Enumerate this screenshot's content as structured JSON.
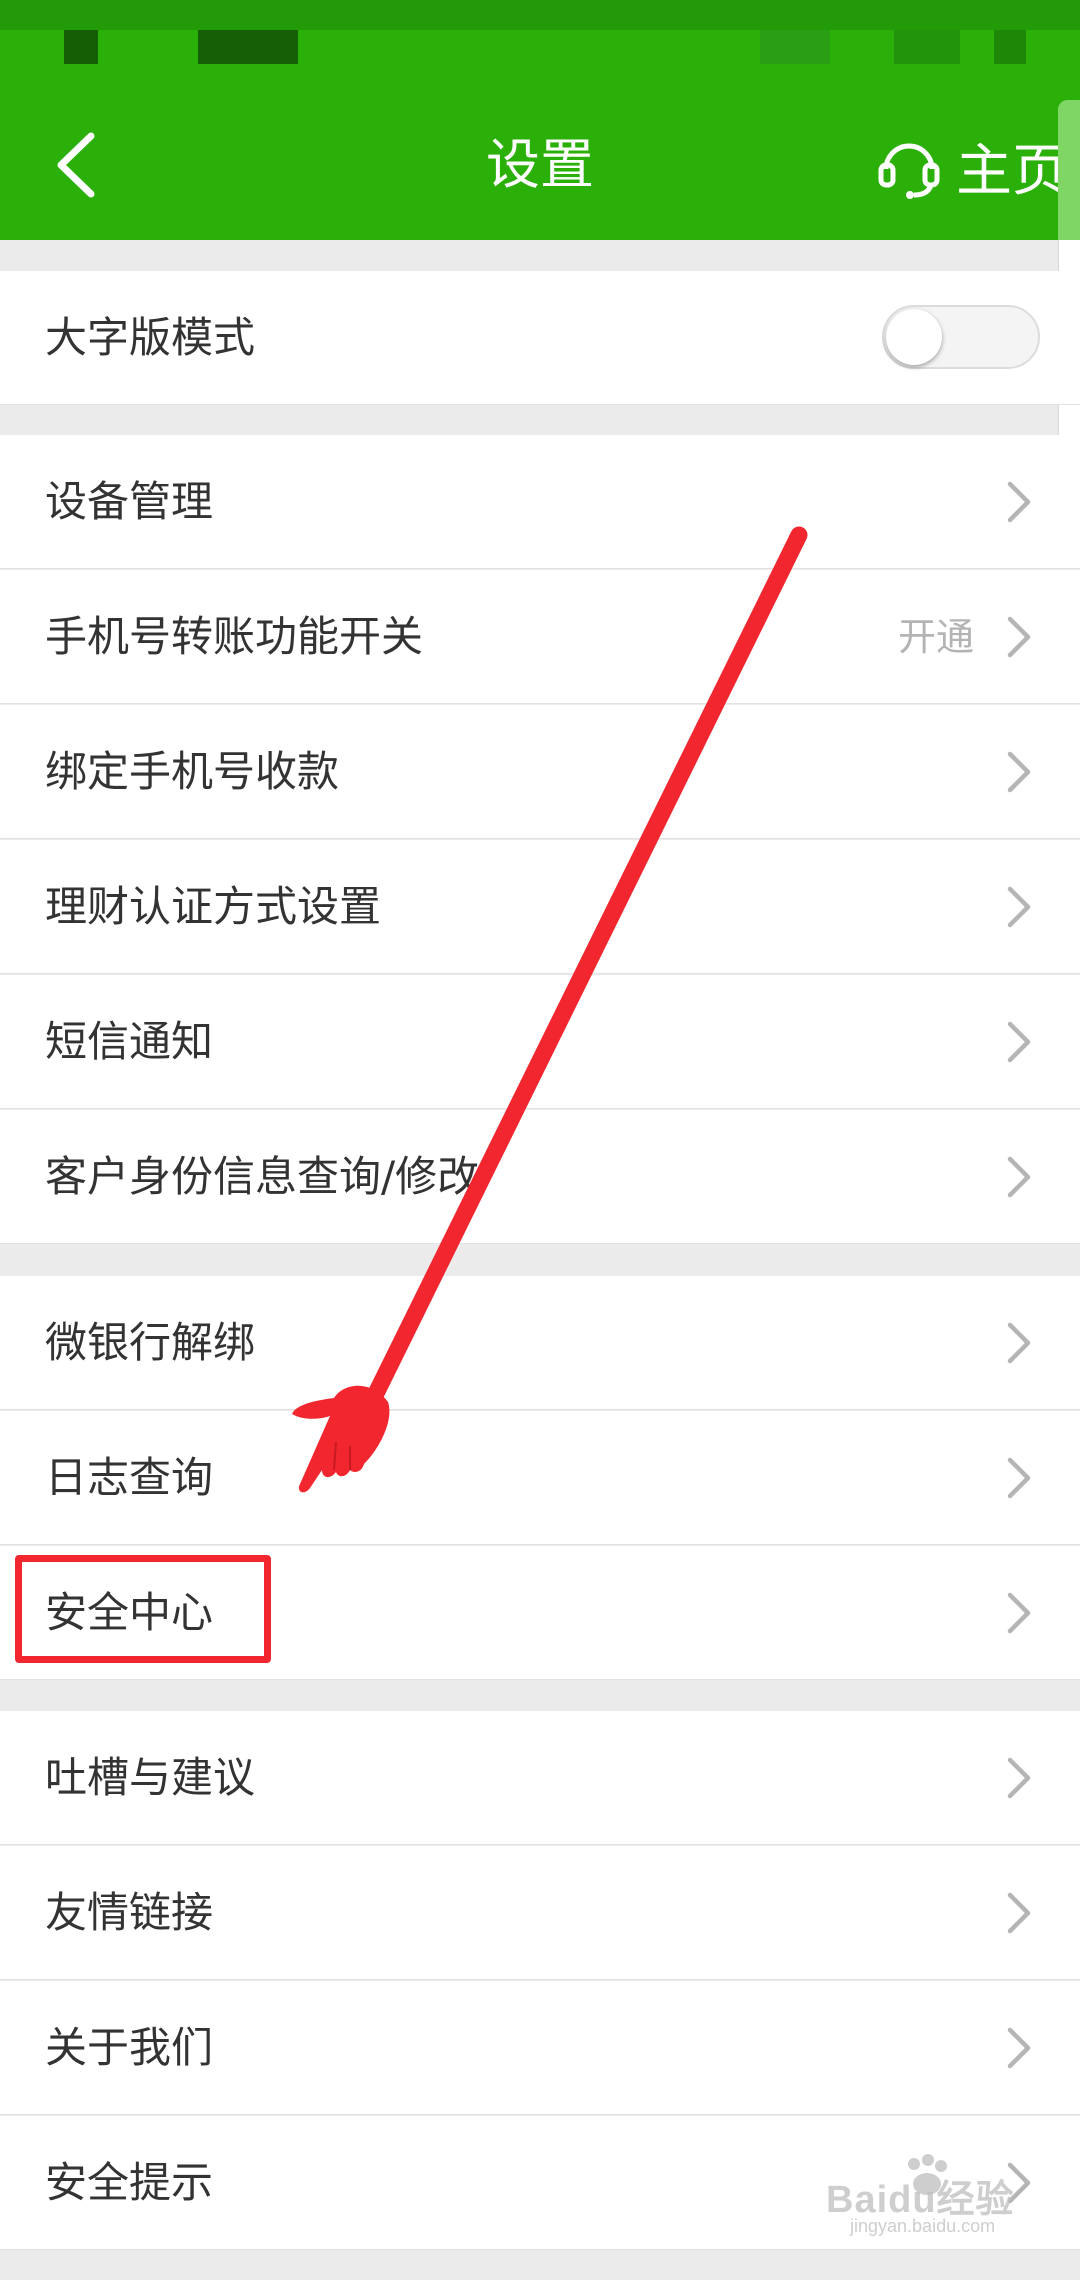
{
  "header": {
    "title": "设置",
    "home_label": "主页"
  },
  "toggle_row": {
    "label": "大字版模式",
    "enabled": false
  },
  "groups": [
    {
      "items": [
        {
          "label": "设备管理",
          "value": ""
        },
        {
          "label": "手机号转账功能开关",
          "value": "开通"
        },
        {
          "label": "绑定手机号收款",
          "value": ""
        },
        {
          "label": "理财认证方式设置",
          "value": ""
        },
        {
          "label": "短信通知",
          "value": ""
        },
        {
          "label": "客户身份信息查询/修改",
          "value": ""
        }
      ]
    },
    {
      "items": [
        {
          "label": "微银行解绑",
          "value": ""
        },
        {
          "label": "日志查询",
          "value": ""
        },
        {
          "label": "安全中心",
          "value": ""
        }
      ]
    },
    {
      "items": [
        {
          "label": "吐槽与建议",
          "value": ""
        },
        {
          "label": "友情链接",
          "value": ""
        },
        {
          "label": "关于我们",
          "value": ""
        },
        {
          "label": "安全提示",
          "value": ""
        }
      ]
    }
  ],
  "watermark": {
    "text": "Baidu经验",
    "sub": "jingyan.baidu.com"
  },
  "colors": {
    "header_bg": "#2bb00a",
    "annotation_red": "#f2262f",
    "value_text": "#b4b4b4"
  },
  "icons": {
    "back": "chevron-left-icon",
    "home": "headset-icon",
    "row_arrow": "chevron-right-icon"
  }
}
